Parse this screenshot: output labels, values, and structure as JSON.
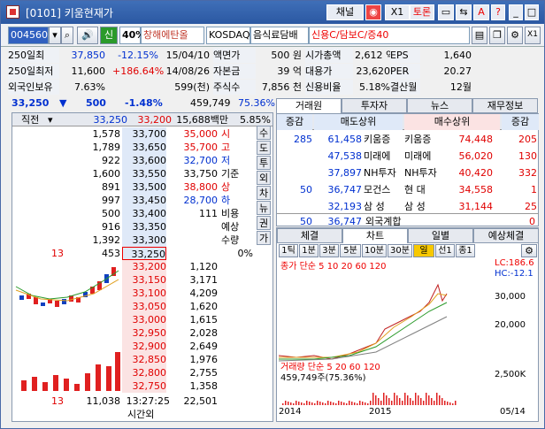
{
  "window": {
    "title": "[0101] 키움현재가",
    "btn_channel": "채널",
    "btn_x1": "X1",
    "btn_toron": "토론",
    "btn_help": "?"
  },
  "toolbar": {
    "code": "004560",
    "market_tag": "신",
    "rate": "40%",
    "name": "창해에탄올",
    "exchange": "KOSDAQ",
    "category": "음식료담배",
    "credit": "신용C/담보C/증40",
    "btn_x1": "X1"
  },
  "info": [
    [
      "250일최",
      "37,850",
      "-12.15%",
      "15/04/10",
      "액면가",
      "500 원",
      "시가총액",
      "2,612 억",
      "EPS",
      "1,640"
    ],
    [
      "250일최저",
      "11,600",
      "+186.64%",
      "14/08/26",
      "자본금",
      "39 억",
      "대용가",
      "23,620",
      "PER",
      "20.27"
    ],
    [
      "외국인보유",
      "7.63%",
      "",
      "599(천)",
      "주식수",
      "7,856 천",
      "신용비율",
      "5.18%",
      "결산월",
      "12월"
    ]
  ],
  "price": {
    "current": "33,250",
    "arrow": "▼",
    "change": "500",
    "rate": "-1.48%",
    "volume": "459,749",
    "vol_rate": "75.36%",
    "mode": "직전",
    "l1": "33,250",
    "l2": "33,200",
    "amount": "15,688백만",
    "amount_rate": "5.85%"
  },
  "asks": [
    {
      "qty": "1,578",
      "price": "33,700"
    },
    {
      "qty": "1,789",
      "price": "33,650"
    },
    {
      "qty": "922",
      "price": "33,600"
    },
    {
      "qty": "1,600",
      "price": "33,550"
    },
    {
      "qty": "891",
      "price": "33,500"
    },
    {
      "qty": "997",
      "price": "33,450"
    },
    {
      "qty": "500",
      "price": "33,400"
    },
    {
      "qty": "916",
      "price": "33,350"
    },
    {
      "qty": "1,392",
      "price": "33,300"
    },
    {
      "qty": "453",
      "price": "33,250",
      "left": "13"
    }
  ],
  "bids": [
    {
      "price": "33,200",
      "qty": "1,120"
    },
    {
      "price": "33,150",
      "qty": "3,171"
    },
    {
      "price": "33,100",
      "qty": "4,209"
    },
    {
      "price": "33,050",
      "qty": "1,620"
    },
    {
      "price": "33,000",
      "qty": "1,615"
    },
    {
      "price": "32,950",
      "qty": "2,028"
    },
    {
      "price": "32,900",
      "qty": "2,649"
    },
    {
      "price": "32,850",
      "qty": "1,976"
    },
    {
      "price": "32,800",
      "qty": "2,755"
    },
    {
      "price": "32,750",
      "qty": "1,358"
    }
  ],
  "summary": [
    {
      "v": "35,000",
      "k": "시",
      "c": "red"
    },
    {
      "v": "35,700",
      "k": "고",
      "c": "red"
    },
    {
      "v": "32,700",
      "k": "저",
      "c": "blue"
    },
    {
      "v": "33,750",
      "k": "기준",
      "c": ""
    },
    {
      "v": "38,800",
      "k": "상",
      "c": "red"
    },
    {
      "v": "28,700",
      "k": "하",
      "c": "blue"
    },
    {
      "v": "111",
      "k": "비용",
      "c": ""
    }
  ],
  "side_tabs": [
    "수",
    "도",
    "투",
    "외",
    "차",
    "뉴",
    "권",
    "가"
  ],
  "misc": {
    "예상": "예상",
    "수량": "수량",
    "pct": "0%",
    "total_left": "13",
    "total_ask": "11,038",
    "time": "13:27:25",
    "total_bid": "22,501",
    "after": "시간외"
  },
  "trade_tabs": [
    "거래원",
    "투자자",
    "뉴스",
    "재무정보"
  ],
  "trade": {
    "h1": "증감",
    "h2": "매도상위",
    "h3": "매수상위",
    "h4": "증감",
    "rows": [
      [
        "285",
        "61,458",
        "키움증",
        "키움증",
        "74,448",
        "205"
      ],
      [
        "",
        "47,538",
        "미래에",
        "미래에",
        "56,020",
        "130"
      ],
      [
        "",
        "37,897",
        "NH투자",
        "NH투자",
        "40,420",
        "332"
      ],
      [
        "50",
        "36,747",
        "모건스",
        "현  대",
        "34,558",
        "1"
      ],
      [
        "",
        "32,193",
        "삼  성",
        "삼  성",
        "31,144",
        "25"
      ]
    ],
    "foot": [
      "50",
      "36,747",
      "외국계합",
      "0"
    ]
  },
  "chart": {
    "tabs": [
      "체결",
      "차트",
      "일별",
      "예상체결"
    ],
    "periods": [
      "1틱",
      "1분",
      "3분",
      "5분",
      "10분",
      "30분",
      "일",
      "선1",
      "종1"
    ],
    "price_label": "종가 단순 5 10 20 60 120",
    "lc": "LC:186.6",
    "hc": "HC:-12.1",
    "vol_label": "거래량 단순 5 20 60 120",
    "vol_value": "459,749주(75.36%)",
    "yticks": [
      "30,000",
      "20,000"
    ],
    "vtick": "2,500K",
    "xlabels": [
      "2014",
      "2015",
      "05/14"
    ]
  },
  "chart_data": {
    "type": "line",
    "title": "종가 단순 5 10 20 60 120"
  }
}
